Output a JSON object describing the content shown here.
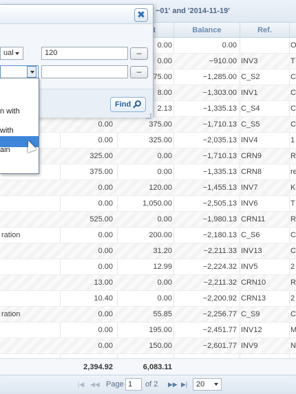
{
  "window": {
    "title": "-01' and '2014-11-19'"
  },
  "columns": {
    "c1": "t",
    "balance": "Balance",
    "ref": "Ref."
  },
  "rows": [
    {
      "a": "",
      "b": "",
      "c": "0.00",
      "bal": "0.00",
      "ref": "",
      "d": "O"
    },
    {
      "a": "",
      "b": "",
      "c": "0.00",
      "bal": "-910.00",
      "ref": "INV3",
      "d": "T"
    },
    {
      "a": "",
      "b": "",
      "c": "75.00",
      "bal": "-1,285.00",
      "ref": "C_S2",
      "d": "C"
    },
    {
      "a": "",
      "b": "",
      "c": "8.00",
      "bal": "-1,303.00",
      "ref": "INV1",
      "d": "C"
    },
    {
      "a": "",
      "b": "",
      "c": "2.13",
      "bal": "-1,335.13",
      "ref": "C_S4",
      "d": "C"
    },
    {
      "a": "",
      "b": "0.00",
      "c": "375.00",
      "bal": "-1,710.13",
      "ref": "C_S5",
      "d": "C"
    },
    {
      "a": "",
      "b": "0.00",
      "c": "325.00",
      "bal": "-2,035.13",
      "ref": "INV4",
      "d": "1"
    },
    {
      "a": "",
      "b": "325.00",
      "c": "0.00",
      "bal": "-1,710.13",
      "ref": "CRN9",
      "d": "R"
    },
    {
      "a": "ation",
      "b": "375.00",
      "c": "0.00",
      "bal": "-1,335.13",
      "ref": "CRN8",
      "d": "re"
    },
    {
      "a": "",
      "b": "0.00",
      "c": "120.00",
      "bal": "-1,455.13",
      "ref": "INV7",
      "d": "K"
    },
    {
      "a": "",
      "b": "0.00",
      "c": "1,050.00",
      "bal": "-2,505.13",
      "ref": "INV6",
      "d": "T"
    },
    {
      "a": "",
      "b": "525.00",
      "c": "0.00",
      "bal": "-1,980.13",
      "ref": "CRN11",
      "d": "R"
    },
    {
      "a": "ration",
      "b": "0.00",
      "c": "200.00",
      "bal": "-2,180.13",
      "ref": "C_S6",
      "d": "C"
    },
    {
      "a": "",
      "b": "0.00",
      "c": "31.20",
      "bal": "-2,211.33",
      "ref": "INV13",
      "d": "C"
    },
    {
      "a": "",
      "b": "0.00",
      "c": "12.99",
      "bal": "-2,224.32",
      "ref": "INV5",
      "d": "2"
    },
    {
      "a": "",
      "b": "13.00",
      "c": "0.00",
      "bal": "-2,211.32",
      "ref": "CRN10",
      "d": "R"
    },
    {
      "a": "",
      "b": "10.40",
      "c": "0.00",
      "bal": "-2,200.92",
      "ref": "CRN13",
      "d": "2"
    },
    {
      "a": "ration",
      "b": "0.00",
      "c": "55.85",
      "bal": "-2,256.77",
      "ref": "C_S9",
      "d": "C"
    },
    {
      "a": "",
      "b": "0.00",
      "c": "195.00",
      "bal": "-2,451.77",
      "ref": "INV12",
      "d": "M"
    },
    {
      "a": "",
      "b": "0.00",
      "c": "150.00",
      "bal": "-2,601.77",
      "ref": "INV9",
      "d": "N"
    }
  ],
  "summary": {
    "b": "2,394.92",
    "c": "6,083.11"
  },
  "pager": {
    "page_label": "Page",
    "page_value": "1",
    "of_label": "of 2",
    "page_size": "20"
  },
  "filter": {
    "operator_value": "ual",
    "value_1": "120",
    "value_2": "",
    "remove_label": "–",
    "find_label": "Find",
    "close_label": "✖",
    "options": [
      "",
      "",
      "n with",
      "",
      "with",
      "",
      "ain"
    ]
  }
}
